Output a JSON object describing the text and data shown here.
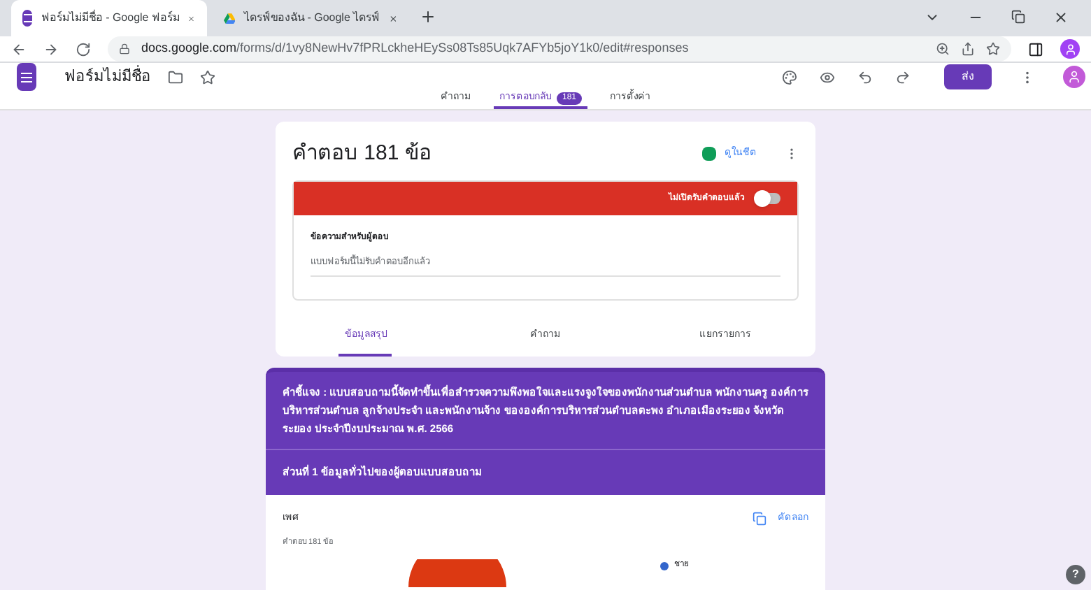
{
  "browser_tabs": [
    {
      "title": "ฟอร์มไม่มีชื่อ - Google ฟอร์ม",
      "selected": true,
      "kind": "forms"
    },
    {
      "title": "ไดรฟ์ของฉัน - Google ไดรฟ์",
      "selected": false,
      "kind": "drive"
    }
  ],
  "address_bar": {
    "host": "docs.google.com",
    "path": "/forms/d/1vy8NewHv7fPRLckheHEySs08Ts85Uqk7AFYb5joY1k0/edit#responses"
  },
  "app_header": {
    "title": "ฟอร์มไม่มีชื่อ",
    "send_button": "ส่ง"
  },
  "nav_tabs": [
    {
      "label": "คำถาม",
      "selected": false
    },
    {
      "label": "การตอบกลับ",
      "selected": true,
      "badge": "181"
    },
    {
      "label": "การตั้งค่า",
      "selected": false
    }
  ],
  "responses_card": {
    "title": "คำตอบ 181 ข้อ",
    "sheets_link": "ดูในชีต",
    "accepting_label": "ไม่เปิดรับคำตอบแล้ว",
    "accepting": false,
    "message_label": "ข้อความสำหรับผู้ตอบ",
    "message_value": "แบบฟอร์มนี้ไม่รับคำตอบอีกแล้ว",
    "tabs": [
      {
        "label": "ข้อมูลสรุป",
        "selected": true
      },
      {
        "label": "คำถาม",
        "selected": false
      },
      {
        "label": "แยกรายการ",
        "selected": false
      }
    ]
  },
  "description": "คำชี้แจง : แบบสอบถามนี้จัดทำขึ้นเพื่อสำรวจความพึงพอใจและแรงจูงใจของพนักงานส่วนตำบล พนักงานครู องค์การบริหารส่วนตำบล ลูกจ้างประจำ และพนักงานจ้าง ขององค์การบริหารส่วนตำบลตะพง อำเภอเมืองระยอง จังหวัดระยอง ประจำปีงบประมาณ พ.ศ. 2566",
  "section_title": "ส่วนที่ 1 ข้อมูลทั่วไปของผู้ตอบแบบสอบถาม",
  "question": {
    "title": "เพศ",
    "count": "คำตอบ 181 ข้อ",
    "copy_button": "คัดลอก",
    "legend": [
      {
        "label": "ชาย",
        "color": "#3366cc"
      }
    ]
  },
  "help_button": "?"
}
